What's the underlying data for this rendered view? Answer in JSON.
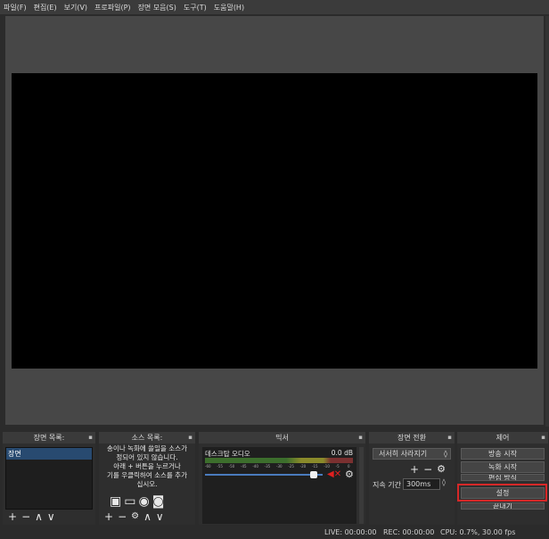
{
  "menu": [
    "파일(F)",
    "편집(E)",
    "보기(V)",
    "프로파일(P)",
    "장면 모음(S)",
    "도구(T)",
    "도움말(H)"
  ],
  "scenes": {
    "title": "장면 목록:",
    "items": [
      "장면"
    ],
    "tools": [
      "+",
      "−",
      "∧",
      "∨"
    ]
  },
  "sources": {
    "title": "소스 목록:",
    "message": [
      "송이나 녹화에 쓸일을 소스가",
      "정되어 있지 않습니다.",
      "아래 + 버튼을 누르거나",
      "기를 우클릭하여 소스를 추가",
      "십시오."
    ],
    "tools": [
      "+",
      "−",
      "⚙",
      "∧",
      "∨"
    ]
  },
  "mixer": {
    "title": "믹서",
    "track_name": "데스크탑 오디오",
    "db_value": "0.0 dB",
    "scale": [
      "-60",
      "-55",
      "-50",
      "-45",
      "-40",
      "-35",
      "-30",
      "-25",
      "-20",
      "-15",
      "-10",
      "-5",
      "0"
    ],
    "volume": 0.95
  },
  "transitions": {
    "title": "장면 전환",
    "type": "서서히 사라지기",
    "duration_label": "지속 기간",
    "duration_value": "300ms"
  },
  "controls": {
    "title": "제어",
    "stream": "방송 시작",
    "record": "녹화 시작",
    "studio": "편집 방식",
    "settings": "설정",
    "exit": "끝내기"
  },
  "status": {
    "live": "LIVE: 00:00:00",
    "rec": "REC: 00:00:00",
    "cpu": "CPU: 0.7%, 30.00 fps"
  },
  "icons": {
    "float": "float-icon",
    "gear": "gear-icon",
    "mute": "speaker-muted-icon"
  }
}
